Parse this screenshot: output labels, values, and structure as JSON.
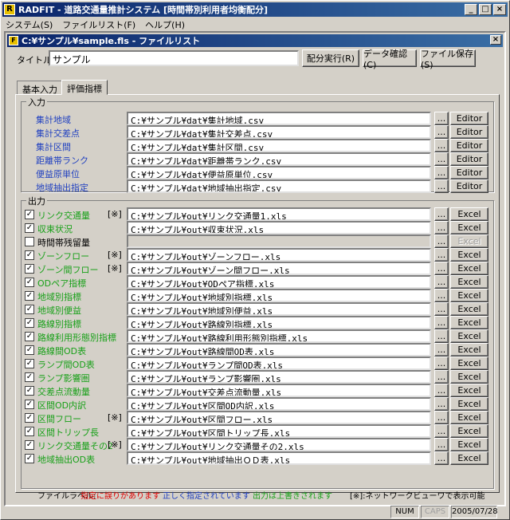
{
  "app_title": "RADFIT - 道路交通量推計システム [時間帯別利用者均衡配分]",
  "window_buttons": {
    "min": "_",
    "max": "□",
    "close": "×"
  },
  "menu": [
    "システム(S)",
    "ファイルリスト(F)",
    "ヘルプ(H)"
  ],
  "doc_title": "C:¥サンプル¥sample.fls - ファイルリスト",
  "title_label": "タイトル",
  "title_value": "サンプル",
  "buttons": {
    "run": "配分実行(R)",
    "check": "データ確認(C)",
    "save": "ファイル保存(S)"
  },
  "tabs": [
    "基本入力",
    "評価指標"
  ],
  "input_group": "入力",
  "output_group": "出力",
  "inputs": [
    {
      "label": "集計地域",
      "path": "C:¥サンプル¥dat¥集計地域.csv",
      "button": "Editor"
    },
    {
      "label": "集計交差点",
      "path": "C:¥サンプル¥dat¥集計交差点.csv",
      "button": "Editor"
    },
    {
      "label": "集計区間",
      "path": "C:¥サンプル¥dat¥集計区間.csv",
      "button": "Editor"
    },
    {
      "label": "距離帯ランク",
      "path": "C:¥サンプル¥dat¥距離帯ランク.csv",
      "button": "Editor"
    },
    {
      "label": "便益原単位",
      "path": "C:¥サンプル¥dat¥便益原単位.csv",
      "button": "Editor"
    },
    {
      "label": "地域抽出指定",
      "path": "C:¥サンプル¥dat¥地域抽出指定.csv",
      "button": "Editor"
    }
  ],
  "browse": "...",
  "outputs": [
    {
      "label": "リンク交通量",
      "mark": "[※]",
      "path": "C:¥サンプル¥out¥リンク交通量1.xls",
      "checked": true,
      "button": "Excel",
      "enabled": true
    },
    {
      "label": "収束状況",
      "mark": "",
      "path": "C:¥サンプル¥out¥収束状況.xls",
      "checked": true,
      "button": "Excel",
      "enabled": true
    },
    {
      "label": "時間帯残留量",
      "mark": "",
      "path": "",
      "checked": false,
      "button": "Excel",
      "enabled": false
    },
    {
      "label": "ゾーンフロー",
      "mark": "[※]",
      "path": "C:¥サンプル¥out¥ゾーンフロー.xls",
      "checked": true,
      "button": "Excel",
      "enabled": true
    },
    {
      "label": "ゾーン間フロー",
      "mark": "[※]",
      "path": "C:¥サンプル¥out¥ゾーン間フロー.xls",
      "checked": true,
      "button": "Excel",
      "enabled": true
    },
    {
      "label": "ODペア指標",
      "mark": "",
      "path": "C:¥サンプル¥out¥ODペア指標.xls",
      "checked": true,
      "button": "Excel",
      "enabled": true
    },
    {
      "label": "地域別指標",
      "mark": "",
      "path": "C:¥サンプル¥out¥地域別指標.xls",
      "checked": true,
      "button": "Excel",
      "enabled": true
    },
    {
      "label": "地域別便益",
      "mark": "",
      "path": "C:¥サンプル¥out¥地域別便益.xls",
      "checked": true,
      "button": "Excel",
      "enabled": true
    },
    {
      "label": "路線別指標",
      "mark": "",
      "path": "C:¥サンプル¥out¥路線別指標.xls",
      "checked": true,
      "button": "Excel",
      "enabled": true
    },
    {
      "label": "路線利用形態別指標",
      "mark": "",
      "path": "C:¥サンプル¥out¥路線利用形態別指標.xls",
      "checked": true,
      "button": "Excel",
      "enabled": true
    },
    {
      "label": "路線間OD表",
      "mark": "",
      "path": "C:¥サンプル¥out¥路線間OD表.xls",
      "checked": true,
      "button": "Excel",
      "enabled": true
    },
    {
      "label": "ランプ間OD表",
      "mark": "",
      "path": "C:¥サンプル¥out¥ランプ間OD表.xls",
      "checked": true,
      "button": "Excel",
      "enabled": true
    },
    {
      "label": "ランプ影響圏",
      "mark": "",
      "path": "C:¥サンプル¥out¥ランプ影響圏.xls",
      "checked": true,
      "button": "Excel",
      "enabled": true
    },
    {
      "label": "交差点流動量",
      "mark": "",
      "path": "C:¥サンプル¥out¥交差点流動量.xls",
      "checked": true,
      "button": "Excel",
      "enabled": true
    },
    {
      "label": "区間OD内訳",
      "mark": "",
      "path": "C:¥サンプル¥out¥区間OD内訳.xls",
      "checked": true,
      "button": "Excel",
      "enabled": true
    },
    {
      "label": "区間フロー",
      "mark": "[※]",
      "path": "C:¥サンプル¥out¥区間フロー.xls",
      "checked": true,
      "button": "Excel",
      "enabled": true
    },
    {
      "label": "区間トリップ長",
      "mark": "",
      "path": "C:¥サンプル¥out¥区間トリップ長.xls",
      "checked": true,
      "button": "Excel",
      "enabled": true
    },
    {
      "label": "リンク交通量その2",
      "mark": "[※]",
      "path": "C:¥サンプル¥out¥リンク交通量その2.xls",
      "checked": true,
      "button": "Excel",
      "enabled": true
    },
    {
      "label": "地域抽出OD表",
      "mark": "",
      "path": "C:¥サンプル¥out¥地域抽出ＯＤ表.xls",
      "checked": true,
      "button": "Excel",
      "enabled": true
    }
  ],
  "legend": {
    "prefix": "ファイルラベル:",
    "error": "指定に誤りがあります",
    "ok": "正しく指定されています",
    "overwrite": "出力は上書きされます",
    "note": "[※]:ネットワークビューワで表示可能"
  },
  "statusbar": [
    "NUM",
    "CAPS",
    "2005/07/28"
  ],
  "colors": {
    "error": "#e00000",
    "ok": "#2040c0",
    "overwrite": "#18a018",
    "title_bar": "#0a246a"
  }
}
